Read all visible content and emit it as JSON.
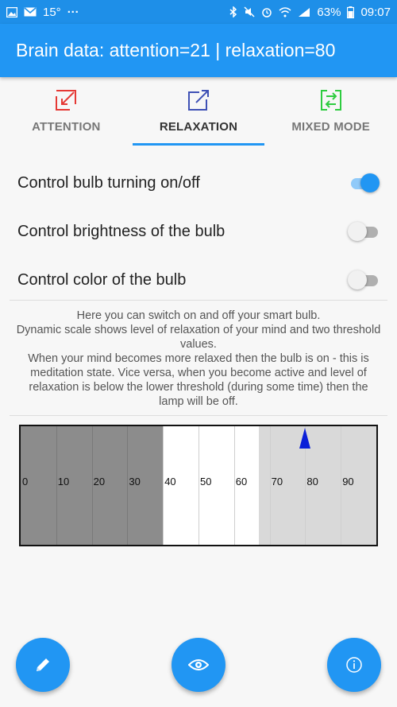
{
  "status_bar": {
    "temperature": "15°",
    "dots": "···",
    "battery": "63%",
    "time": "09:07",
    "icons": [
      "image-icon",
      "mail-icon",
      "bluetooth-icon",
      "mute-icon",
      "alarm-icon",
      "wifi-icon",
      "signal-icon",
      "battery-icon"
    ]
  },
  "app_bar": {
    "title": "Brain data: attention=21 | relaxation=80"
  },
  "tabs": [
    {
      "label": "ATTENTION",
      "icon": "attention-arrow-icon",
      "color": "#e53935",
      "active": false
    },
    {
      "label": "RELAXATION",
      "icon": "relaxation-arrow-icon",
      "color": "#3f51b5",
      "active": true
    },
    {
      "label": "MIXED MODE",
      "icon": "mixed-mode-arrows-icon",
      "color": "#2ecc40",
      "active": false
    }
  ],
  "settings": [
    {
      "label": "Control bulb turning on/off",
      "on": true
    },
    {
      "label": "Control brightness of the bulb",
      "on": false
    },
    {
      "label": "Control color of the bulb",
      "on": false
    }
  ],
  "description": {
    "lines": [
      "Here you can switch on and off your smart bulb.",
      "Dynamic scale shows level of relaxation of your mind and two threshold values.",
      "When your mind becomes more relaxed then the bulb is on - this is meditation state. Vice versa, when you become active and level of relaxation is below the lower threshold (during some time) then the lamp will be off."
    ]
  },
  "scale": {
    "ticks": [
      "0",
      "10",
      "20",
      "30",
      "40",
      "50",
      "60",
      "70",
      "80",
      "90"
    ],
    "lower_threshold": 40,
    "upper_threshold": 67,
    "current_value": 80,
    "low_zone_color": "#8c8c8c",
    "mid_zone_color": "#ffffff",
    "high_zone_color": "#d9d9d9",
    "marker_color": "#0a1fd8"
  },
  "fabs": [
    {
      "name": "edit-button",
      "icon": "pencil-icon"
    },
    {
      "name": "view-button",
      "icon": "eye-icon"
    },
    {
      "name": "info-button",
      "icon": "info-icon"
    }
  ],
  "colors": {
    "primary": "#2196f3",
    "status_bar": "#1e8fe8",
    "switch_on_thumb": "#2196f3",
    "switch_on_track": "#90caf9",
    "switch_off_thumb": "#f1f1f1",
    "switch_off_track": "#b0b0b0"
  }
}
